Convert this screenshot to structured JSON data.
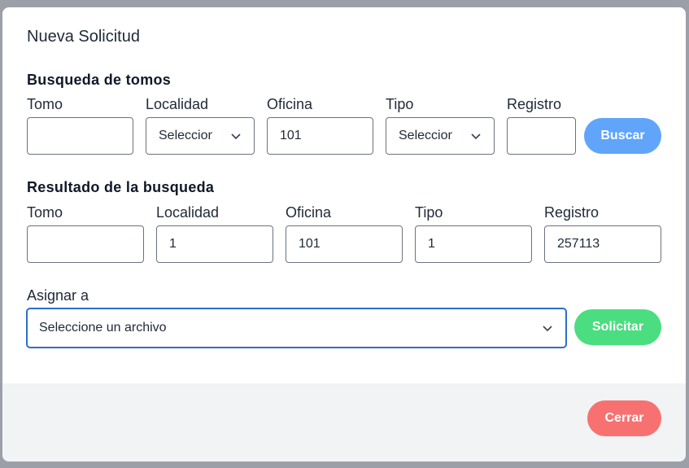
{
  "dialog": {
    "title": "Nueva Solicitud"
  },
  "search": {
    "heading": "Busqueda de tomos",
    "labels": {
      "tomo": "Tomo",
      "localidad": "Localidad",
      "oficina": "Oficina",
      "tipo": "Tipo",
      "registro": "Registro"
    },
    "values": {
      "tomo": "",
      "localidad": "Seleccione",
      "oficina": "101",
      "tipo": "Seleccione",
      "registro": ""
    },
    "button": "Buscar"
  },
  "result": {
    "heading": "Resultado de la busqueda",
    "labels": {
      "tomo": "Tomo",
      "localidad": "Localidad",
      "oficina": "Oficina",
      "tipo": "Tipo",
      "registro": "Registro"
    },
    "values": {
      "tomo": "",
      "localidad": "1",
      "oficina": "101",
      "tipo": "1",
      "registro": "257113"
    }
  },
  "assign": {
    "label": "Asignar a",
    "selected": "Seleccione un archivo",
    "button": "Solicitar"
  },
  "footer": {
    "close": "Cerrar"
  },
  "icons": {
    "select_arrow": "chevron-down-icon"
  },
  "colors": {
    "buscar": "#60a5fa",
    "solicitar": "#4ade80",
    "cerrar": "#f87171",
    "focus_border": "#2a6fc9"
  }
}
